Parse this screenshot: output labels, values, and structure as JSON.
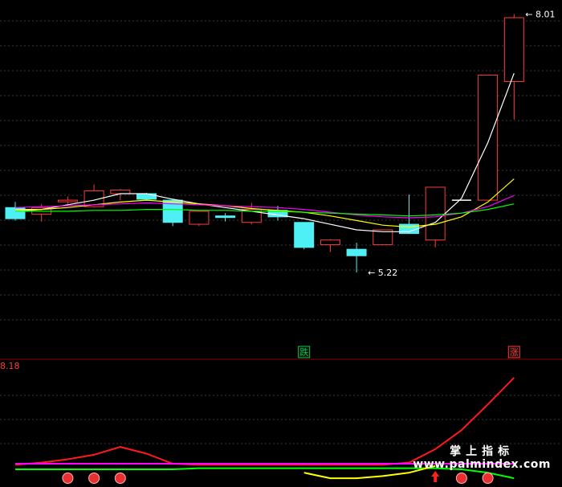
{
  "chart_data": [
    {
      "type": "candlestick",
      "title": "",
      "ylim": [
        4.5,
        8.1
      ],
      "grid": true,
      "candles": [
        {
          "o": 5.92,
          "h": 5.98,
          "l": 5.78,
          "c": 5.8,
          "dir": "down"
        },
        {
          "o": 5.85,
          "h": 5.96,
          "l": 5.77,
          "c": 5.92,
          "dir": "up"
        },
        {
          "o": 6.0,
          "h": 6.04,
          "l": 5.96,
          "c": 6.0,
          "dir": "up"
        },
        {
          "o": 5.93,
          "h": 6.17,
          "l": 5.92,
          "c": 6.1,
          "dir": "up"
        },
        {
          "o": 6.07,
          "h": 6.12,
          "l": 6.0,
          "c": 6.11,
          "dir": "up"
        },
        {
          "o": 6.07,
          "h": 6.08,
          "l": 6.0,
          "c": 6.01,
          "dir": "down"
        },
        {
          "o": 6.0,
          "h": 6.0,
          "l": 5.72,
          "c": 5.76,
          "dir": "down"
        },
        {
          "o": 5.88,
          "h": 5.88,
          "l": 5.72,
          "c": 5.74,
          "dir": "up"
        },
        {
          "o": 5.82,
          "h": 5.86,
          "l": 5.77,
          "c": 5.83,
          "dir": "down"
        },
        {
          "o": 5.76,
          "h": 5.97,
          "l": 5.74,
          "c": 5.9,
          "dir": "up"
        },
        {
          "o": 5.89,
          "h": 5.94,
          "l": 5.78,
          "c": 5.82,
          "dir": "down"
        },
        {
          "o": 5.76,
          "h": 5.76,
          "l": 5.47,
          "c": 5.49,
          "dir": "down"
        },
        {
          "o": 5.52,
          "h": 5.58,
          "l": 5.44,
          "c": 5.57,
          "dir": "up"
        },
        {
          "o": 5.47,
          "h": 5.54,
          "l": 5.22,
          "c": 5.4,
          "dir": "down"
        },
        {
          "o": 5.52,
          "h": 5.68,
          "l": 5.52,
          "c": 5.68,
          "dir": "up"
        },
        {
          "o": 5.74,
          "h": 6.06,
          "l": 5.64,
          "c": 5.64,
          "dir": "down"
        },
        {
          "o": 5.57,
          "h": 6.14,
          "l": 5.49,
          "c": 6.14,
          "dir": "up"
        },
        {
          "o": 6.0,
          "h": 6.0,
          "l": 6.0,
          "c": 6.0,
          "dir": "flat"
        },
        {
          "o": 6.0,
          "h": 7.35,
          "l": 7.25,
          "c": 7.35,
          "dir": "up"
        },
        {
          "o": 7.28,
          "h": 8.01,
          "l": 6.87,
          "c": 7.97,
          "dir": "up"
        }
      ],
      "series": [
        {
          "color": "#ffffff",
          "values": [
            5.88,
            5.9,
            5.95,
            6.0,
            6.07,
            6.07,
            6.01,
            5.96,
            5.92,
            5.88,
            5.84,
            5.8,
            5.74,
            5.68,
            5.66,
            5.66,
            5.76,
            6.02,
            6.62,
            7.37
          ]
        },
        {
          "color": "#ffff00",
          "values": [
            5.9,
            5.9,
            5.92,
            5.95,
            5.98,
            6.0,
            5.98,
            5.96,
            5.94,
            5.91,
            5.89,
            5.87,
            5.83,
            5.78,
            5.73,
            5.71,
            5.74,
            5.82,
            5.98,
            6.23
          ]
        },
        {
          "color": "#ff00ff",
          "values": [
            5.92,
            5.93,
            5.94,
            5.95,
            5.96,
            5.97,
            5.96,
            5.95,
            5.94,
            5.93,
            5.92,
            5.9,
            5.87,
            5.84,
            5.82,
            5.81,
            5.82,
            5.86,
            5.93,
            6.05
          ]
        },
        {
          "color": "#00ff00",
          "values": [
            5.88,
            5.88,
            5.88,
            5.89,
            5.89,
            5.9,
            5.9,
            5.89,
            5.89,
            5.88,
            5.88,
            5.87,
            5.86,
            5.85,
            5.84,
            5.83,
            5.84,
            5.86,
            5.9,
            5.96
          ]
        }
      ],
      "annotations": [
        {
          "text": "8.01",
          "candle": 19,
          "price": 8.01
        },
        {
          "text": "5.22",
          "candle": 13,
          "price": 5.22
        }
      ],
      "signals": [
        {
          "text": "跌",
          "candle": 11,
          "color": "#00cc44"
        },
        {
          "text": "涨",
          "candle": 19,
          "color": "#ff3333"
        }
      ]
    },
    {
      "type": "line",
      "top_label": "8.18",
      "ylim": [
        0,
        8.18
      ],
      "series": [
        {
          "color": "#ff1a1a",
          "values": [
            0.4,
            0.6,
            0.9,
            1.3,
            2.0,
            1.4,
            0.5,
            0.4,
            0.4,
            0.4,
            0.4,
            0.4,
            0.4,
            0.4,
            0.4,
            0.6,
            1.8,
            3.5,
            5.8,
            8.18
          ]
        },
        {
          "color": "#ff00ff",
          "values": [
            0.5,
            0.5,
            0.5,
            0.5,
            0.5,
            0.5,
            0.5,
            0.5,
            0.5,
            0.5,
            0.5,
            0.5,
            0.5,
            0.5,
            0.5,
            0.5,
            0.5,
            0.5,
            0.5,
            0.5
          ]
        },
        {
          "color": "#00ff00",
          "values": [
            0.0,
            0.0,
            0.0,
            0.0,
            0.0,
            0.0,
            0.0,
            0.1,
            0.1,
            0.1,
            0.1,
            0.1,
            0.1,
            0.1,
            0.1,
            0.1,
            0.1,
            0.0,
            -0.3,
            -0.8
          ]
        },
        {
          "color": "#ffff00",
          "values": [
            null,
            null,
            null,
            null,
            null,
            null,
            null,
            null,
            null,
            null,
            null,
            -0.3,
            -0.8,
            -0.8,
            -0.6,
            -0.3,
            0.3,
            null,
            null,
            null
          ]
        }
      ],
      "markers": [
        {
          "candle": 2,
          "label": "balloon"
        },
        {
          "candle": 3,
          "label": "balloon"
        },
        {
          "candle": 4,
          "label": "balloon"
        },
        {
          "candle": 16,
          "label": "up-arrow"
        },
        {
          "candle": 17,
          "label": "balloon"
        },
        {
          "candle": 18,
          "label": "balloon"
        }
      ]
    }
  ],
  "watermark": {
    "line1": "掌上指标",
    "line2": "www.palmindex.com"
  }
}
